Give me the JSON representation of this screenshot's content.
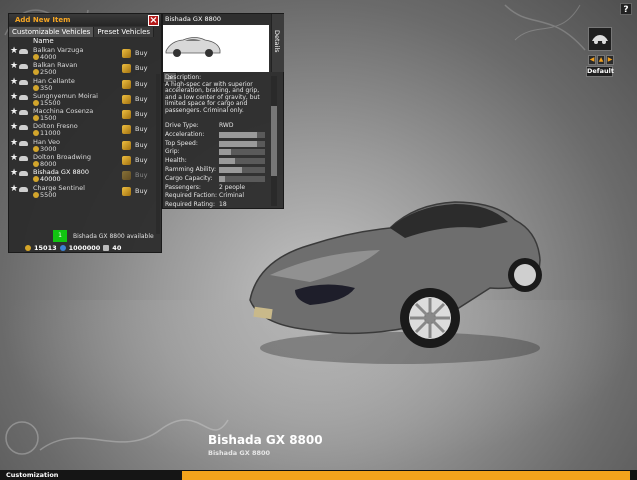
{
  "panel": {
    "title": "Add New Item",
    "tabs": [
      "Customizable Vehicles",
      "Preset Vehicles"
    ],
    "column_header": "Name",
    "buy_label": "Buy",
    "vehicles": [
      {
        "name": "Balkan Varzuga",
        "price": "4000"
      },
      {
        "name": "Balkan Ravan",
        "price": "2500"
      },
      {
        "name": "Han Cellante",
        "price": "350"
      },
      {
        "name": "Sungnyemun Moirai",
        "price": "15500"
      },
      {
        "name": "Macchina Cosenza",
        "price": "1500"
      },
      {
        "name": "Dolton Fresno",
        "price": "11000"
      },
      {
        "name": "Han Veo",
        "price": "3000"
      },
      {
        "name": "Dolton Broadwing",
        "price": "8000"
      },
      {
        "name": "Bishada GX 8800",
        "price": "40000"
      },
      {
        "name": "Charge Sentinel",
        "price": "5500"
      }
    ],
    "available_count": "1",
    "available_text": "Bishada GX 8800 available",
    "money": {
      "gold": "15013",
      "blue": "1000000",
      "items": "40"
    }
  },
  "details": {
    "title": "Bishada GX 8800",
    "tab_label": "Details",
    "description": "Description:\nA high-spec car with superior acceleration, braking, and grip, and a low center of gravity, but limited space for cargo and passengers. Criminal only.",
    "stats": [
      {
        "label": "Drive Type:",
        "value": "RWD"
      },
      {
        "label": "Acceleration:",
        "bar": 0.82
      },
      {
        "label": "Top Speed:",
        "bar": 0.82
      },
      {
        "label": "Grip:",
        "bar": 0.25
      },
      {
        "label": "Health:",
        "bar": 0.35
      },
      {
        "label": "Ramming Ability:",
        "bar": 0.5
      },
      {
        "label": "Cargo Capacity:",
        "bar": 0.12
      },
      {
        "label": "Passengers:",
        "value": "2 people"
      },
      {
        "label": "Required Faction:",
        "value": "Criminal"
      },
      {
        "label": "Required Rating:",
        "value": "18"
      }
    ]
  },
  "controls": {
    "help": "?",
    "default": "Default"
  },
  "caption": {
    "title": "Bishada GX 8800",
    "subtitle": "Bishada GX 8800"
  },
  "footer": {
    "label": "Customization"
  },
  "colors": {
    "accent": "#f3a31c",
    "available": "#11c411",
    "close": "#b51a1a"
  }
}
